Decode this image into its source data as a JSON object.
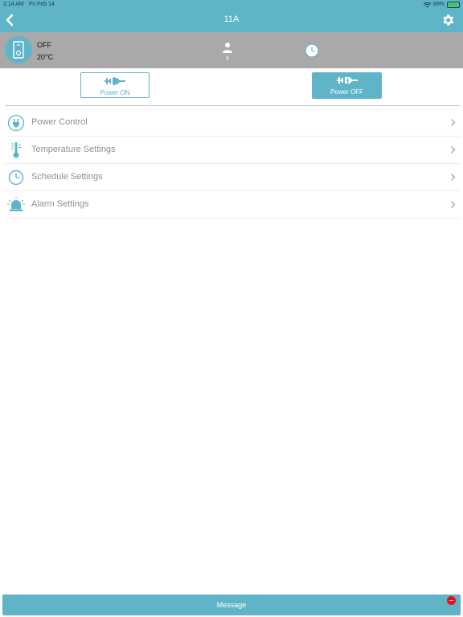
{
  "status_bar": {
    "time": "2:14 AM",
    "date": "Fri Feb 14",
    "battery": "89%",
    "battery_level": 0.89
  },
  "header": {
    "title": "11A",
    "back_icon": "chevron-left-icon",
    "settings_icon": "gear-icon"
  },
  "device": {
    "status": "OFF",
    "temperature": "20°C",
    "person_count": "5",
    "icons": [
      "device-icon",
      "person-icon",
      "clock-icon"
    ]
  },
  "power_buttons": {
    "on_label": "Power ON",
    "off_label": "Power OFF",
    "selected": "off"
  },
  "menu": {
    "items": [
      {
        "label": "Power Control",
        "icon": "power-plug-icon"
      },
      {
        "label": "Temperature Settings",
        "icon": "thermometer-icon"
      },
      {
        "label": "Schedule Settings",
        "icon": "clock-icon"
      },
      {
        "label": "Alarm Settings",
        "icon": "alarm-light-icon"
      }
    ]
  },
  "footer": {
    "message_label": "Message"
  },
  "colors": {
    "accent": "#5fb5c7",
    "device_bar": "#a9a9a9",
    "text_muted": "#8f8f8f",
    "notification": "#e8111a"
  }
}
